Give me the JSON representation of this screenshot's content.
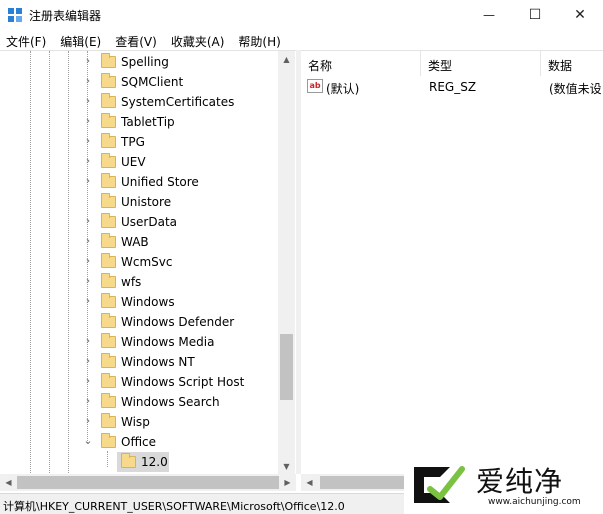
{
  "window": {
    "title": "注册表编辑器",
    "min_glyph": "—",
    "max_glyph": "☐",
    "close_glyph": "✕"
  },
  "menu": [
    "文件(F)",
    "编辑(E)",
    "查看(V)",
    "收藏夹(A)",
    "帮助(H)"
  ],
  "tree": {
    "items": [
      {
        "label": "Spelling",
        "expander": "›"
      },
      {
        "label": "SQMClient",
        "expander": "›"
      },
      {
        "label": "SystemCertificates",
        "expander": "›"
      },
      {
        "label": "TabletTip",
        "expander": "›"
      },
      {
        "label": "TPG",
        "expander": "›"
      },
      {
        "label": "UEV",
        "expander": "›"
      },
      {
        "label": "Unified Store",
        "expander": "›"
      },
      {
        "label": "Unistore",
        "expander": ""
      },
      {
        "label": "UserData",
        "expander": "›"
      },
      {
        "label": "WAB",
        "expander": "›"
      },
      {
        "label": "WcmSvc",
        "expander": "›"
      },
      {
        "label": "wfs",
        "expander": "›"
      },
      {
        "label": "Windows",
        "expander": "›"
      },
      {
        "label": "Windows Defender",
        "expander": ""
      },
      {
        "label": "Windows Media",
        "expander": "›"
      },
      {
        "label": "Windows NT",
        "expander": "›"
      },
      {
        "label": "Windows Script Host",
        "expander": "›"
      },
      {
        "label": "Windows Search",
        "expander": "›"
      },
      {
        "label": "Wisp",
        "expander": "›"
      },
      {
        "label": "Office",
        "expander": "⌄"
      }
    ],
    "selected_child": "12.0"
  },
  "columns": {
    "name": "名称",
    "type": "类型",
    "data": "数据"
  },
  "values": [
    {
      "icon": "ab",
      "name": "(默认)",
      "type": "REG_SZ",
      "data": "(数值未设"
    }
  ],
  "status": "计算机\\HKEY_CURRENT_USER\\SOFTWARE\\Microsoft\\Office\\12.0",
  "watermark": {
    "text": "爱纯净",
    "url": "www.aichunjing.com"
  },
  "colors": {
    "folder": "#f6d98a",
    "selection": "#d9d9d9",
    "watermark_green": "#7cc242"
  }
}
